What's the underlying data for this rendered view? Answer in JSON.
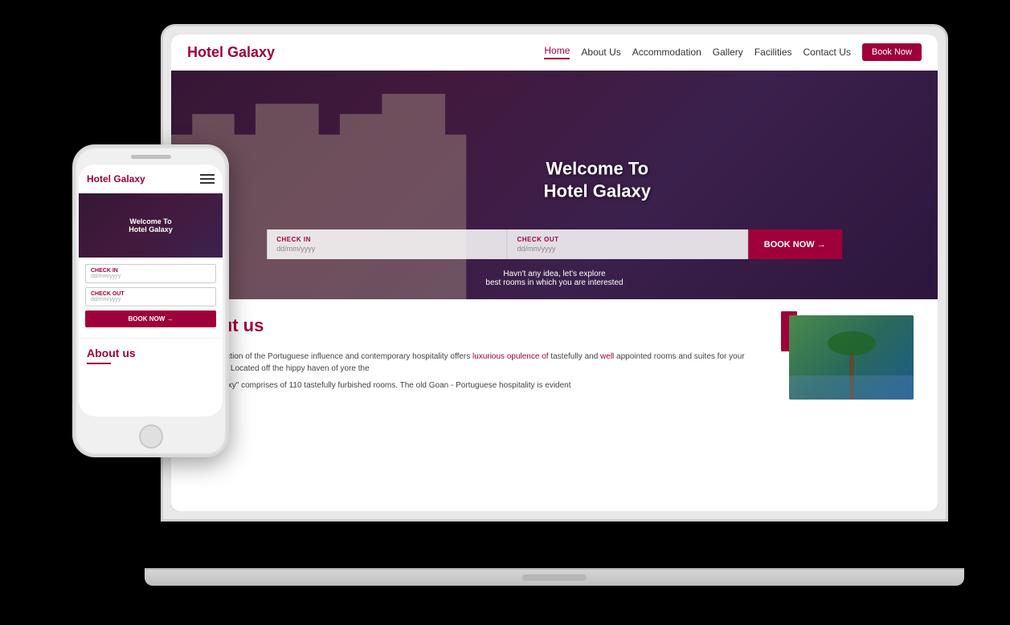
{
  "scene": {
    "background": "#000"
  },
  "laptop": {
    "logo": "Hotel Galaxy",
    "nav": {
      "items": [
        {
          "label": "Home",
          "active": true
        },
        {
          "label": "About Us",
          "active": false
        },
        {
          "label": "Accommodation",
          "active": false
        },
        {
          "label": "Gallery",
          "active": false
        },
        {
          "label": "Facilities",
          "active": false
        },
        {
          "label": "Contact Us",
          "active": false
        }
      ],
      "book_now": "Book Now"
    },
    "hero": {
      "title_line1": "Welcome To",
      "title_line2": "Hotel Galaxy",
      "checkin_label": "CHECK IN",
      "checkin_placeholder": "dd/mm/yyyy",
      "checkout_label": "CHECK OUT",
      "checkout_placeholder": "dd/mm/yyyy",
      "book_now_btn": "BOOK NOW →",
      "tagline_line1": "Havn't any idea, let's explore",
      "tagline_line2": "best rooms in which you are interested"
    },
    "about": {
      "heading": "About us",
      "para1": "A true reflection of the Portuguese influence and contemporary hospitality offers luxurious opulence of tastefully and well appointed rooms and suites for your indulgence. Located off the hippy haven of yore the",
      "para2": "\"Hotel Galaxy\" comprises of 110 tastefully furbished rooms. The old Goan - Portuguese hospitality is evident"
    }
  },
  "phone": {
    "logo": "Hotel Galaxy",
    "hamburger_label": "menu",
    "hero": {
      "title_line1": "Welcome To",
      "title_line2": "Hotel Galaxy"
    },
    "checkin_label": "CHECK IN",
    "checkin_placeholder": "dd/mm/yyyy",
    "checkout_label": "CHECK OUT",
    "checkout_placeholder": "dd/mm/yyyy",
    "book_now_btn": "BOOK NOW →",
    "about_heading": "About us"
  },
  "colors": {
    "brand_red": "#a0003a",
    "nav_active": "#a0003a",
    "hero_bg_from": "#2d1a2e",
    "hero_bg_to": "#1a1a40"
  }
}
